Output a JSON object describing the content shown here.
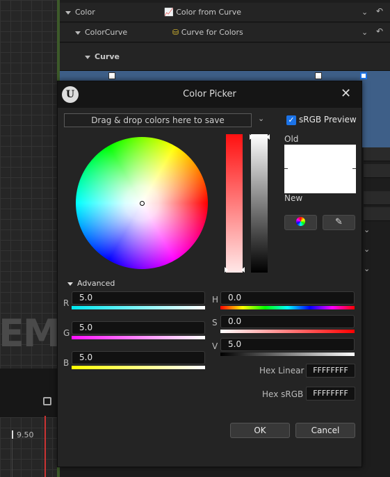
{
  "details": {
    "rows": [
      {
        "label": "Color",
        "value": "Color from Curve"
      },
      {
        "label": "ColorCurve",
        "value": "Curve for Colors"
      },
      {
        "label": "Curve"
      }
    ]
  },
  "background": {
    "watermark": "EM",
    "timeline_value": "9.50"
  },
  "dialog": {
    "title": "Color Picker",
    "close_glyph": "✕",
    "dropzone_text": "Drag & drop colors here to save",
    "srgb_label": "sRGB Preview",
    "srgb_checked": true,
    "old_label": "Old",
    "new_label": "New",
    "old_color": "#FFFFFF",
    "new_color": "#FFFFFF",
    "advanced_label": "Advanced",
    "channels": {
      "r": {
        "label": "R",
        "value": "5.0"
      },
      "g": {
        "label": "G",
        "value": "5.0"
      },
      "b": {
        "label": "B",
        "value": "5.0"
      },
      "h": {
        "label": "H",
        "value": "0.0"
      },
      "s": {
        "label": "S",
        "value": "0.0"
      },
      "v": {
        "label": "V",
        "value": "5.0"
      }
    },
    "hex_linear": {
      "label": "Hex Linear",
      "value": "FFFFFFFF"
    },
    "hex_srgb": {
      "label": "Hex sRGB",
      "value": "FFFFFFFF"
    },
    "ok_label": "OK",
    "cancel_label": "Cancel"
  },
  "icons": {
    "logo": "unreal-engine-logo",
    "eyedropper": "eyedropper-icon",
    "color_wheel": "color-wheel-icon"
  },
  "colors": {
    "accent": "#1B73E8",
    "curve_bar": "#3E5F88"
  }
}
